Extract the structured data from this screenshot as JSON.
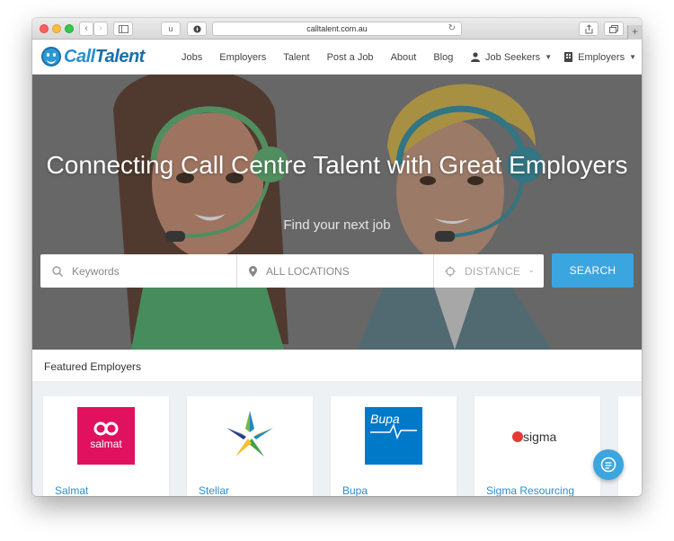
{
  "browser": {
    "url": "calltalent.com.au",
    "ext_label": "u",
    "new_tab": "+"
  },
  "site": {
    "logo_part1": "Call",
    "logo_part2": "Talent",
    "nav": [
      "Jobs",
      "Employers",
      "Talent",
      "Post a Job",
      "About",
      "Blog"
    ],
    "user_menu": {
      "job_seekers": "Job Seekers",
      "employers": "Employers"
    }
  },
  "hero": {
    "title": "Connecting Call Centre Talent with Great Employers",
    "subtitle": "Find your next job",
    "search": {
      "keywords_placeholder": "Keywords",
      "location_placeholder": "ALL LOCATIONS",
      "distance_label": "DISTANCE",
      "button": "SEARCH"
    }
  },
  "featured": {
    "heading": "Featured Employers",
    "employers": [
      {
        "name": "Salmat",
        "logo_text": "salmat",
        "color": "#e0115f"
      },
      {
        "name": "Stellar",
        "logo_text": "",
        "color": "#1e88c8"
      },
      {
        "name": "Bupa",
        "logo_text": "Bupa",
        "color": "#0079c8"
      },
      {
        "name": "Sigma Resourcing",
        "logo_text": "sigma",
        "color": "#e53935"
      }
    ]
  },
  "colors": {
    "accent": "#3ba5e0",
    "brand": "#2a8fd0"
  }
}
